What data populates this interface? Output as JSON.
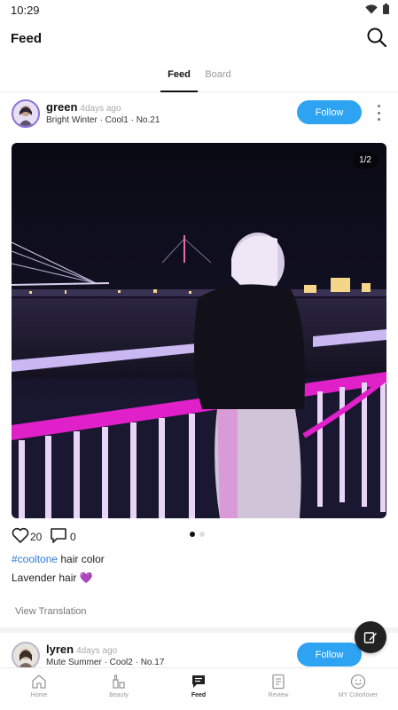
{
  "status_bar": {
    "time": "10:29",
    "icons": [
      "wifi-icon",
      "battery-icon"
    ]
  },
  "header": {
    "title": "Feed",
    "search_icon": "search-icon"
  },
  "tabs": [
    {
      "label": "Feed",
      "active": true
    },
    {
      "label": "Board",
      "active": false
    }
  ],
  "posts": [
    {
      "user": "green",
      "time": "4days ago",
      "meta": "Bright Winter · Cool1 · No.21",
      "follow_label": "Follow",
      "image_page": "1/2",
      "likes": "20",
      "comments": "0",
      "caption_hashtag": "#cooltone",
      "caption_rest": " hair color",
      "caption_line2": "Lavender hair 💜",
      "translate_label": "View Translation"
    },
    {
      "user": "lyren",
      "time": "4days ago",
      "meta": "Mute Summer · Cool2 · No.17",
      "follow_label": "Follow"
    }
  ],
  "bottom_nav": [
    {
      "label": "Home",
      "icon": "home-icon",
      "active": false
    },
    {
      "label": "Beauty",
      "icon": "beauty-icon",
      "active": false
    },
    {
      "label": "Feed",
      "icon": "feed-icon",
      "active": true
    },
    {
      "label": "Review",
      "icon": "review-icon",
      "active": false
    },
    {
      "label": "MY Colorlover",
      "icon": "profile-icon",
      "active": false
    }
  ],
  "colors": {
    "accent": "#2ea3f2",
    "hashtag": "#2e7dd6",
    "avatar_ring": "#8a6fd6",
    "fab": "#222222"
  }
}
